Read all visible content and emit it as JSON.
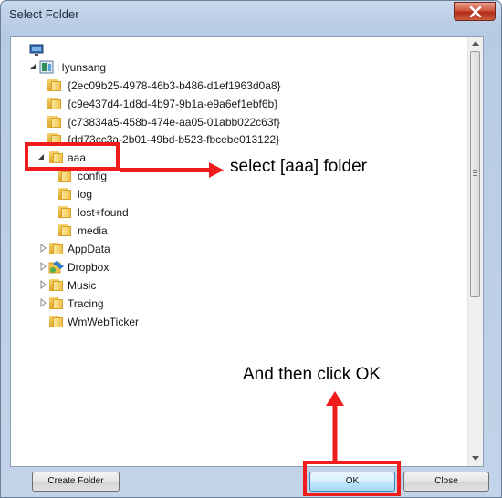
{
  "window": {
    "title": "Select Folder"
  },
  "tree": {
    "computer": "",
    "root": "Hyunsang",
    "guids": [
      "{2ec09b25-4978-46b3-b486-d1ef1963d0a8}",
      "{c9e437d4-1d8d-4b97-9b1a-e9a6ef1ebf6b}",
      "{c73834a5-458b-474e-aa05-01abb022c63f}",
      "{dd73cc3a-2b01-49bd-b523-fbcebe013122}"
    ],
    "aaa": {
      "label": "aaa",
      "children": [
        "config",
        "log",
        "lost+found",
        "media"
      ]
    },
    "others": [
      "AppData",
      "Dropbox",
      "Music",
      "Tracing",
      "WmWebTicker"
    ]
  },
  "buttons": {
    "create_folder": "Create Folder",
    "ok": "OK",
    "close": "Close"
  },
  "annotations": {
    "select_aaa": "select [aaa] folder",
    "click_ok": "And then click OK",
    "color": "#ee1c1c"
  },
  "colors": {
    "folder": "#f0c34d",
    "titlebar": "#b7cbe4",
    "close_button": "#c7412b",
    "highlight": "#ee1c1c"
  }
}
